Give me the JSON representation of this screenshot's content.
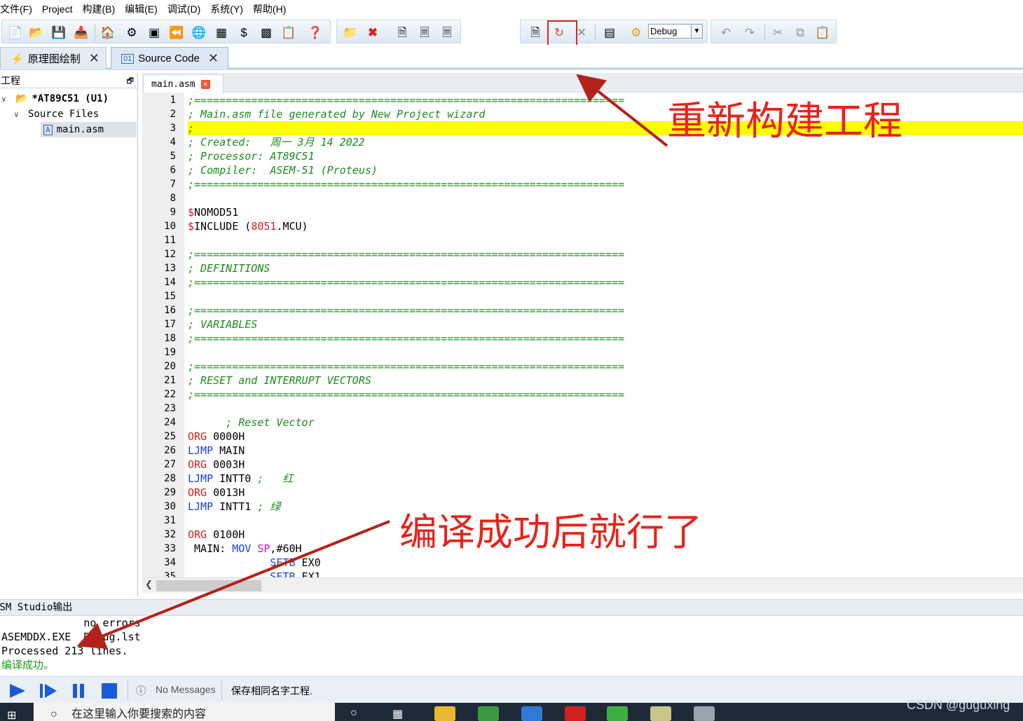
{
  "menu": [
    "文件(F)",
    "Project",
    "构建(B)",
    "编辑(E)",
    "调试(D)",
    "系统(Y)",
    "帮助(H)"
  ],
  "toolbar": {
    "config_value": "Debug"
  },
  "doc_tabs": [
    {
      "label": "原理图绘制",
      "icon": "schematic-icon",
      "active": false
    },
    {
      "label": "Source Code",
      "icon": "source-code-icon",
      "active": true
    }
  ],
  "project": {
    "title": "工程",
    "root": "*AT89C51 (U1)",
    "folder": "Source Files",
    "file": "main.asm"
  },
  "editor": {
    "tab": "main.asm",
    "line_numbers": [
      "1",
      "2",
      "3",
      "4",
      "5",
      "6",
      "7",
      "8",
      "9",
      "10",
      "11",
      "12",
      "13",
      "14",
      "15",
      "16",
      "17",
      "18",
      "19",
      "20",
      "21",
      "22",
      "23",
      "24",
      "25",
      "26",
      "27",
      "28",
      "29",
      "30",
      "31",
      "32",
      "33",
      "34",
      "35"
    ],
    "lines": [
      [
        [
          "cmt",
          ";===================================================================="
        ]
      ],
      [
        [
          "cmt",
          "; Main.asm file generated by New Project wizard"
        ]
      ],
      [
        [
          "cmt",
          ";"
        ]
      ],
      [
        [
          "cmt",
          "; Created:   周一 3月 14 2022"
        ]
      ],
      [
        [
          "cmt",
          "; Processor: AT89C51"
        ]
      ],
      [
        [
          "cmt",
          "; Compiler:  ASEM-51 (Proteus)"
        ]
      ],
      [
        [
          "cmt",
          ";===================================================================="
        ]
      ],
      [],
      [
        [
          "dlr",
          "$"
        ],
        [
          "plain",
          "NOMOD51"
        ]
      ],
      [
        [
          "dlr",
          "$"
        ],
        [
          "plain",
          "INCLUDE ("
        ],
        [
          "kw-red",
          "8051"
        ],
        [
          "plain",
          ".MCU)"
        ]
      ],
      [],
      [
        [
          "cmt",
          ";===================================================================="
        ]
      ],
      [
        [
          "cmt",
          "; DEFINITIONS"
        ]
      ],
      [
        [
          "cmt",
          ";===================================================================="
        ]
      ],
      [],
      [
        [
          "cmt",
          ";===================================================================="
        ]
      ],
      [
        [
          "cmt",
          "; VARIABLES"
        ]
      ],
      [
        [
          "cmt",
          ";===================================================================="
        ]
      ],
      [],
      [
        [
          "cmt",
          ";===================================================================="
        ]
      ],
      [
        [
          "cmt",
          "; RESET and INTERRUPT VECTORS"
        ]
      ],
      [
        [
          "cmt",
          ";===================================================================="
        ]
      ],
      [],
      [
        [
          "plain",
          "      "
        ],
        [
          "cmt",
          "; Reset Vector"
        ]
      ],
      [
        [
          "kw-red",
          "ORG"
        ],
        [
          "plain",
          " 0000H"
        ]
      ],
      [
        [
          "kw-blue",
          "LJMP"
        ],
        [
          "plain",
          " MAIN"
        ]
      ],
      [
        [
          "kw-red",
          "ORG"
        ],
        [
          "plain",
          " 0003H"
        ]
      ],
      [
        [
          "kw-blue",
          "LJMP"
        ],
        [
          "plain",
          " INTT0 "
        ],
        [
          "cmt",
          ";   红"
        ]
      ],
      [
        [
          "kw-red",
          "ORG"
        ],
        [
          "plain",
          " 0013H"
        ]
      ],
      [
        [
          "kw-blue",
          "LJMP"
        ],
        [
          "plain",
          " INTT1 "
        ],
        [
          "cmt",
          "; 绿"
        ]
      ],
      [],
      [
        [
          "kw-red",
          "ORG"
        ],
        [
          "plain",
          " 0100H"
        ]
      ],
      [
        [
          "plain",
          " MAIN: "
        ],
        [
          "kw-blue",
          "MOV"
        ],
        [
          "plain",
          " "
        ],
        [
          "kw-mag",
          "SP"
        ],
        [
          "plain",
          ",#60H"
        ]
      ],
      [
        [
          "plain",
          "             "
        ],
        [
          "kw-blue",
          "SETB"
        ],
        [
          "plain",
          " EX0"
        ]
      ],
      [
        [
          "plain",
          "             "
        ],
        [
          "kw-blue",
          "SETB"
        ],
        [
          "plain",
          " EX1"
        ]
      ]
    ],
    "highlight_line": 3
  },
  "output": {
    "title": "VSM Studio输出",
    "lines": [
      "             no errors",
      "ASEMDDX.EXE  Debug.lst",
      "Processed 213 lines."
    ],
    "success": "编译成功。"
  },
  "status": {
    "messages": "No Messages",
    "text": "保存相同名字工程."
  },
  "taskbar": {
    "search_placeholder": "在这里输入你要搜索的内容"
  },
  "watermark": "CSDN @guguxing",
  "annotations": {
    "rebuild": "重新构建工程",
    "success_note": "编译成功后就行了"
  },
  "colors": {
    "annotation": "#e8231a",
    "highlight": "#ffff00",
    "comment": "#1e8a1e"
  }
}
